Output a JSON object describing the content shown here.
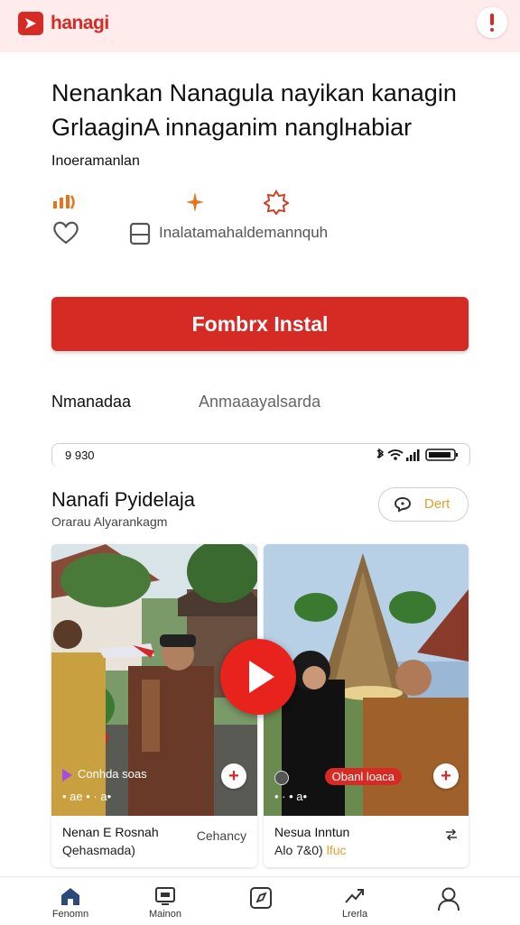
{
  "header": {
    "logo_text": "hanagi",
    "logo_icon": "play-logo-icon",
    "alert_icon": "alert-icon"
  },
  "app": {
    "headline_line1": "Nenankan Nanagula nayikan kanagin",
    "headline_line2": "GrlaaginA innaganim nanglнabiar",
    "subtitle": "Inoeramanlan",
    "meta_text": "Inalatamahaldemannquh",
    "install_label": "Fombrx Instal"
  },
  "tabs": [
    {
      "label": "Nmanadaa"
    },
    {
      "label": "Anmaaayalsarda"
    }
  ],
  "status": {
    "time": "9 930"
  },
  "section": {
    "title": "Nanafi Pyidelaja",
    "subtitle": "Orarau Alyarankagm",
    "sort_label": "Dert"
  },
  "cards": [
    {
      "overlay_label": "Conhda soas",
      "overlay_stats": "• ae • · a•",
      "title": "Nenan E Rosnah",
      "subtitle": "Qehasmada)",
      "tag": "Cehancy"
    },
    {
      "overlay_label": "Obanl loaca",
      "overlay_stats": "• · • a•",
      "title": "Nesua Inntun",
      "subtitle": "Alo 7&0)",
      "price": "lfuc"
    }
  ],
  "nav": [
    {
      "label": "Fenomn",
      "icon": "home-icon"
    },
    {
      "label": "Mainon",
      "icon": "tv-icon"
    },
    {
      "label": "",
      "icon": "explore-icon"
    },
    {
      "label": "Lrerla",
      "icon": "trending-icon"
    },
    {
      "label": "",
      "icon": "profile-icon"
    }
  ],
  "colors": {
    "brand_red": "#d62a24",
    "accent_gold": "#e0a02a",
    "header_bg": "#fdeceb"
  }
}
